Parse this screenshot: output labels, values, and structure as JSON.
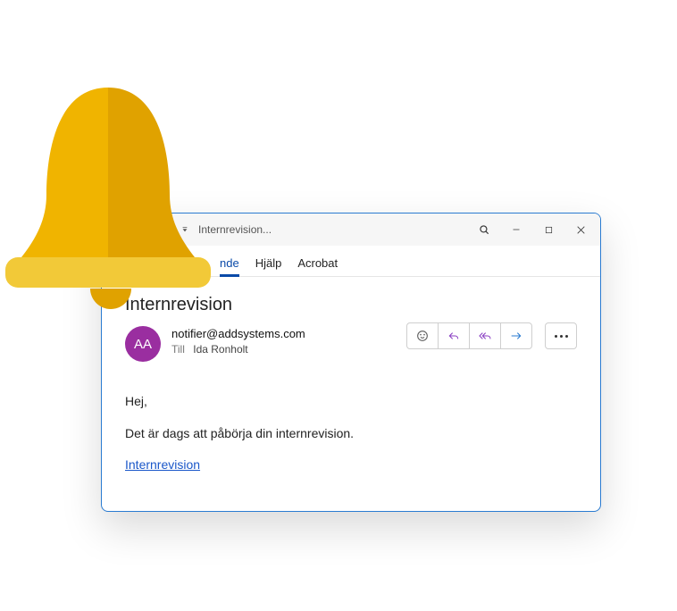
{
  "titlebar": {
    "title": "Internrevision..."
  },
  "menu": {
    "items": [
      {
        "label": "nde",
        "active": true
      },
      {
        "label": "Hjälp"
      },
      {
        "label": "Acrobat"
      }
    ]
  },
  "message": {
    "subject": "Internrevision",
    "avatar_initials": "AA",
    "from": "notifier@addsystems.com",
    "to_label": "Till",
    "to": "Ida Ronholt",
    "body_hello": "Hej,",
    "body_line1": "Det är dags att påbörja din internrevision.",
    "link_text": "Internrevision"
  }
}
